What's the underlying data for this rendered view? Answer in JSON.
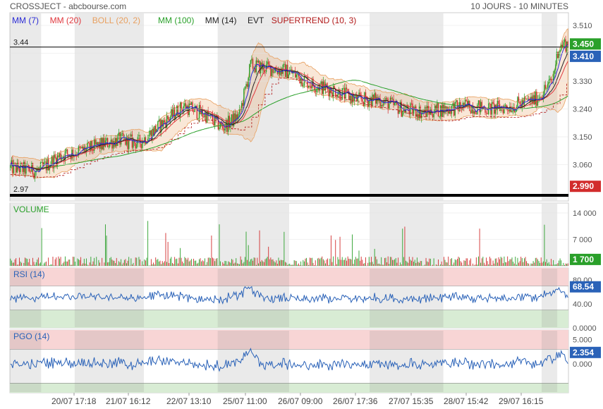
{
  "header": {
    "title": "CROSSJECT - abcbourse.com",
    "period": "10 JOURS - 10 MINUTES"
  },
  "colors": {
    "mm7": "#2b2bd6",
    "mm20": "#e0383e",
    "boll": "#e8a060",
    "mm100": "#2aa02a",
    "mm14": "#222222",
    "supertrend": "#b01818",
    "up": "#2aa02a",
    "down": "#d22c2c",
    "rsi": "#2a62b8",
    "pgo": "#2a62b8"
  },
  "chart_data": [
    {
      "type": "candlestick",
      "legend": [
        {
          "label": "MM (7)",
          "color": "#2b2bd6"
        },
        {
          "label": "MM (20)",
          "color": "#e0383e"
        },
        {
          "label": "BOLL (20, 2)",
          "color": "#e8a060"
        },
        {
          "label": "MM (100)",
          "color": "#2aa02a"
        },
        {
          "label": "MM (14)",
          "color": "#222222"
        },
        {
          "label": "EVT",
          "color": "#222222"
        },
        {
          "label": "SUPERTREND (10, 3)",
          "color": "#b01818"
        }
      ],
      "yticks": [
        "3.510",
        "3.420",
        "3.330",
        "3.240",
        "3.150",
        "3.060",
        "2.970"
      ],
      "ylim": [
        2.97,
        3.51
      ],
      "x_labels": [
        "20/07 17:18",
        "21/07 16:12",
        "22/07 13:10",
        "25/07 11:00",
        "26/07 09:00",
        "26/07 17:36",
        "27/07 15:35",
        "28/07 15:42",
        "29/07 16:15"
      ],
      "anchors": [
        [
          0,
          3.05
        ],
        [
          25,
          3.04
        ],
        [
          45,
          3.09
        ],
        [
          70,
          3.11
        ],
        [
          95,
          3.14
        ],
        [
          115,
          3.13
        ],
        [
          135,
          3.19
        ],
        [
          155,
          3.25
        ],
        [
          175,
          3.22
        ],
        [
          190,
          3.18
        ],
        [
          205,
          3.22
        ],
        [
          215,
          3.38
        ],
        [
          235,
          3.37
        ],
        [
          250,
          3.36
        ],
        [
          270,
          3.32
        ],
        [
          290,
          3.3
        ],
        [
          310,
          3.27
        ],
        [
          330,
          3.27
        ],
        [
          350,
          3.24
        ],
        [
          370,
          3.23
        ],
        [
          390,
          3.24
        ],
        [
          410,
          3.25
        ],
        [
          430,
          3.24
        ],
        [
          450,
          3.25
        ],
        [
          470,
          3.27
        ],
        [
          485,
          3.33
        ],
        [
          490,
          3.43
        ],
        [
          495,
          3.45
        ]
      ],
      "levels": {
        "high": "3.44",
        "low": "2.97"
      },
      "badges": {
        "last": "3.450",
        "prev": "3.410",
        "low": "2.990"
      }
    },
    {
      "type": "bar",
      "title": "VOLUME",
      "yticks": [
        "14 000",
        "7 000"
      ],
      "ylim": [
        0,
        14000
      ],
      "last": "1 700"
    },
    {
      "type": "line",
      "title": "RSI (14)",
      "yticks": [
        "80.00",
        "40.00",
        "0.0000"
      ],
      "ylim": [
        0,
        100
      ],
      "bands": [
        30,
        70
      ],
      "last": "68.54"
    },
    {
      "type": "line",
      "title": "PGO (14)",
      "yticks": [
        "5.000",
        "0.000"
      ],
      "ylim": [
        -6,
        7
      ],
      "bands": [
        -4,
        3
      ],
      "last": "2.354"
    }
  ]
}
